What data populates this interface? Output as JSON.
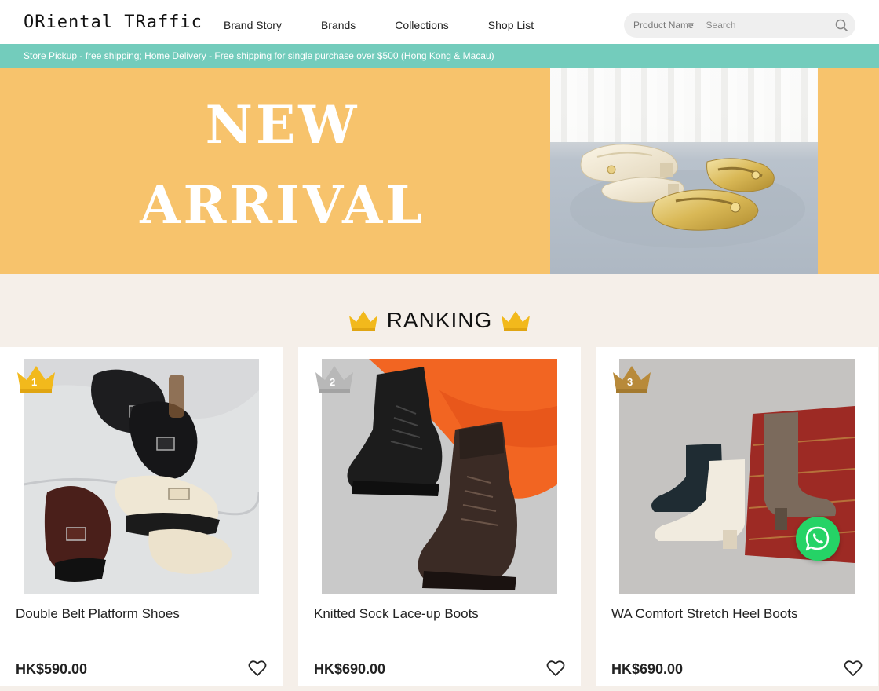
{
  "header": {
    "logo": "ORiental TRaffic",
    "nav": [
      "Brand Story",
      "Brands",
      "Collections",
      "Shop List"
    ],
    "search": {
      "type_label": "Product Name",
      "placeholder": "Search"
    }
  },
  "announcement": "Store Pickup - free shipping; Home Delivery - Free shipping for single purchase over $500 (Hong Kong & Macau)",
  "banner": {
    "line1": "NEW",
    "line2": "ARRIVAL"
  },
  "ranking": {
    "title": "RANKING",
    "products": [
      {
        "rank": "1",
        "name": "Double Belt Platform Shoes",
        "price": "HK$590.00"
      },
      {
        "rank": "2",
        "name": "Knitted Sock Lace-up Boots",
        "price": "HK$690.00"
      },
      {
        "rank": "3",
        "name": "WA Comfort Stretch Heel Boots",
        "price": "HK$690.00"
      }
    ]
  },
  "colors": {
    "accent_bar": "#73ccbc",
    "banner_bg": "#f7c36c",
    "page_bg": "#f5efe9",
    "crown_gold": "#f2b91c",
    "whatsapp": "#25d366"
  },
  "icons": {
    "search": "search-icon",
    "favorite": "heart-icon",
    "chat": "whatsapp-icon",
    "ranking": "crown-icon"
  }
}
